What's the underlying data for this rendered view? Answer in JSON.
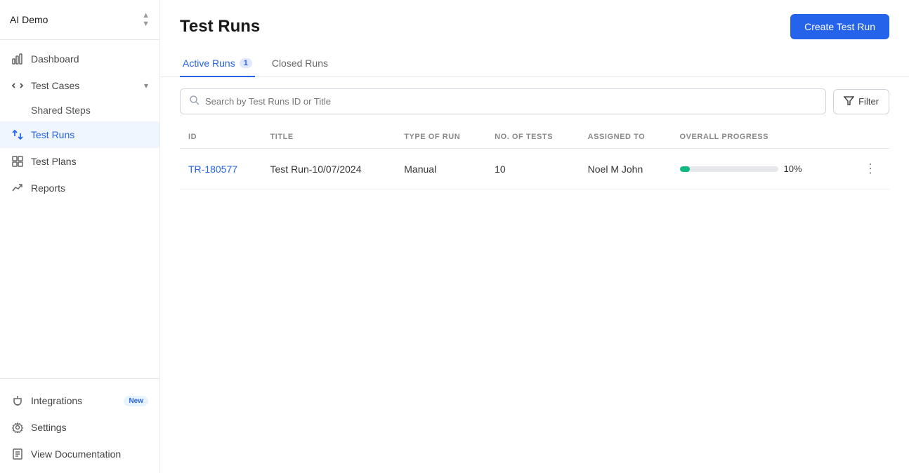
{
  "workspace": {
    "name": "AI Demo",
    "chevron_label": "expand-collapse"
  },
  "sidebar": {
    "items": [
      {
        "id": "dashboard",
        "label": "Dashboard",
        "icon": "bar-chart-icon",
        "active": false
      },
      {
        "id": "test-cases",
        "label": "Test Cases",
        "icon": "chevron-code-icon",
        "active": false,
        "expandable": true,
        "expanded": true
      },
      {
        "id": "shared-steps",
        "label": "Shared Steps",
        "icon": null,
        "active": false,
        "sub": true
      },
      {
        "id": "test-runs",
        "label": "Test Runs",
        "icon": "code-icon",
        "active": true
      },
      {
        "id": "test-plans",
        "label": "Test Plans",
        "icon": "grid-icon",
        "active": false
      },
      {
        "id": "reports",
        "label": "Reports",
        "icon": "chart-icon",
        "active": false
      }
    ],
    "bottom_items": [
      {
        "id": "integrations",
        "label": "Integrations",
        "icon": "plug-icon",
        "badge": "New"
      },
      {
        "id": "settings",
        "label": "Settings",
        "icon": "gear-icon"
      },
      {
        "id": "view-documentation",
        "label": "View Documentation",
        "icon": "doc-icon"
      }
    ]
  },
  "page": {
    "title": "Test Runs",
    "create_button_label": "Create Test Run"
  },
  "tabs": [
    {
      "id": "active-runs",
      "label": "Active Runs",
      "count": "1",
      "active": true
    },
    {
      "id": "closed-runs",
      "label": "Closed Runs",
      "count": null,
      "active": false
    }
  ],
  "search": {
    "placeholder": "Search by Test Runs ID or Title"
  },
  "filter": {
    "label": "Filter"
  },
  "table": {
    "columns": [
      {
        "id": "id",
        "label": "ID"
      },
      {
        "id": "title",
        "label": "TITLE"
      },
      {
        "id": "type",
        "label": "TYPE OF RUN"
      },
      {
        "id": "num_tests",
        "label": "NO. OF TESTS"
      },
      {
        "id": "assigned_to",
        "label": "ASSIGNED TO"
      },
      {
        "id": "progress",
        "label": "OVERALL PROGRESS"
      }
    ],
    "rows": [
      {
        "id": "TR-180577",
        "title": "Test Run-10/07/2024",
        "type": "Manual",
        "num_tests": "10",
        "assigned_to": "Noel M John",
        "progress_pct": 10,
        "progress_label": "10%"
      }
    ]
  }
}
